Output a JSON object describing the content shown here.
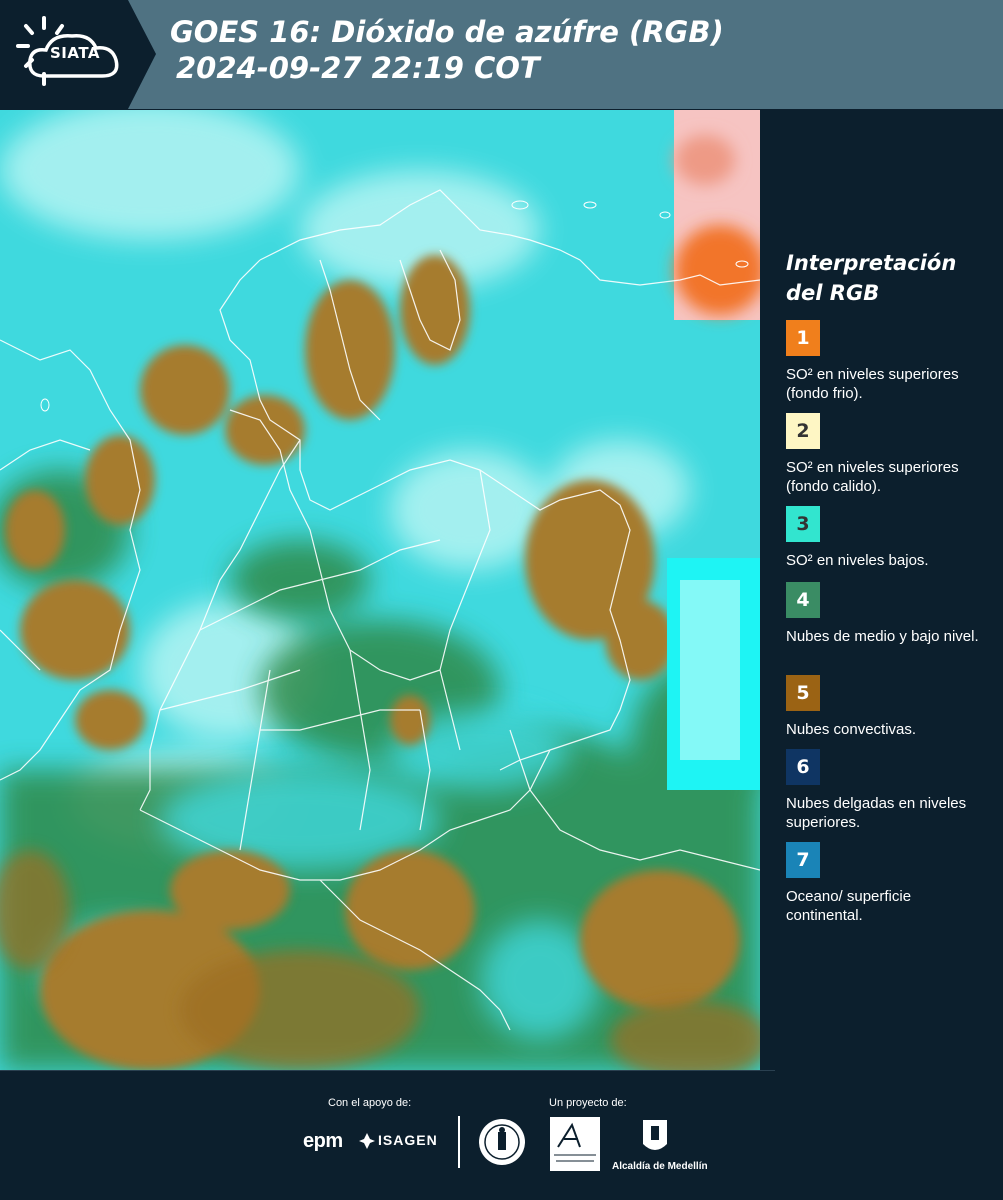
{
  "header": {
    "logo_text": "SIATA",
    "title_line1": "GOES 16: Dióxido de azúfre (RGB)",
    "title_line2": "2024-09-27 22:19 COT"
  },
  "legend": {
    "title_line1": "Interpretación",
    "title_line2": "del RGB",
    "items": [
      {
        "number": "1",
        "color": "#f07f1c",
        "text": "SO² en niveles superiores (fondo frio)."
      },
      {
        "number": "2",
        "color": "#fef6c4",
        "text": "SO² en niveles superiores (fondo calido)."
      },
      {
        "number": "3",
        "color": "#32e5cf",
        "text": "SO² en niveles bajos."
      },
      {
        "number": "4",
        "color": "#3a8c64",
        "text": "Nubes de medio y bajo nivel."
      },
      {
        "number": "5",
        "color": "#9b6314",
        "text": "Nubes convectivas."
      },
      {
        "number": "6",
        "color": "#0f3563",
        "text": "Nubes delgadas en niveles superiores."
      },
      {
        "number": "7",
        "color": "#1a84b7",
        "text": "Oceano/ superficie continental."
      }
    ]
  },
  "map": {
    "colors": {
      "cyan": "#3fd9de",
      "pale_cyan": "#a8f2f2",
      "convective_brown": "#a67b2e",
      "green": "#2f8a4a",
      "orange": "#f2742a",
      "pink": "#f7c9c8",
      "borders": "#ffffff"
    }
  },
  "footer": {
    "support_label": "Con el apoyo de:",
    "project_label": "Un proyecto de:",
    "epm_text": "epm",
    "isagen_text": "ISAGEN",
    "alcaldia_text": "Alcaldía de Medellín"
  }
}
